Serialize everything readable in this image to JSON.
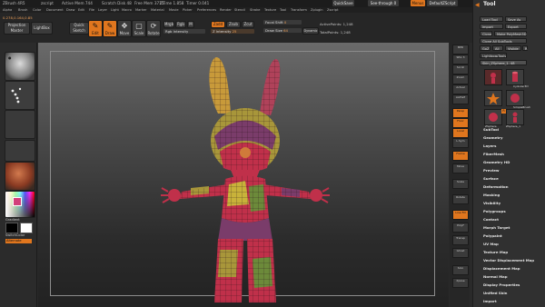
{
  "title_bar": {
    "app": "ZBrush 4R5",
    "items": [
      "zscript",
      "Active Mem 744",
      "Scratch Disk 48",
      "Free Mem 3715",
      "ZTime 1.858",
      "Timer 0.041"
    ],
    "quicksave": "QuickSave",
    "seethrough": "See-through  0",
    "menus": "Menus",
    "default_script": "DefaultZScript"
  },
  "menu_bar": [
    "Alpha",
    "Brush",
    "Color",
    "Document",
    "Draw",
    "Edit",
    "File",
    "Layer",
    "Light",
    "Macro",
    "Marker",
    "Material",
    "Movie",
    "Picker",
    "Preferences",
    "Render",
    "Stencil",
    "Stroke",
    "Texture",
    "Tool",
    "Transform",
    "Zplugin",
    "Zscript"
  ],
  "coords": "0.278,0.164,0.85",
  "shelf": {
    "projection_master": "Projection Master",
    "lightbox": "LightBox",
    "quick_sketch": "Quick Sketch",
    "edit": "Edit",
    "draw": "Draw",
    "move": "Move",
    "scale": "Scale",
    "rotate": "Rotate",
    "mrgb": "Mrgb",
    "rgb": "Rgb",
    "m": "M",
    "zadd": "Zadd",
    "zsub": "Zsub",
    "zcut": "Zcut",
    "rgb_intensity": "Rgb Intensity",
    "z_intensity": "Z Intensity",
    "z_intensity_val": "25",
    "focal_shift": "Focal Shift",
    "focal_shift_val": "0",
    "draw_size": "Draw Size",
    "draw_size_val": "64",
    "dynamic": "Dynamic",
    "active_points": "ActivePoints: 1,248",
    "total_points": "TotalPoints: 1,248"
  },
  "left_shelf": {
    "gradient": "Gradient",
    "switch_color": "SwitchColor",
    "alternate": "Alternate"
  },
  "right_icons": [
    "BPR",
    "SPix 3",
    "Scroll",
    "Zoom",
    "Actual",
    "AAHalf",
    "Persp",
    "Floor",
    "Local",
    "L.Sym",
    "Frame",
    "Move",
    "Scale",
    "Rotate",
    "Line Fill",
    "PolyF",
    "Transp",
    "Ghost",
    "Solo",
    "Xpose"
  ],
  "tool_palette": {
    "title": "Tool",
    "load_tool": "Load Tool",
    "save_as": "Save As",
    "import": "Import",
    "export": "Export",
    "clone": "Clone",
    "make_polymesh": "Make PolyMesh3D",
    "clone_all": "Clone All SubTools",
    "goz": "GoZ",
    "all": "All",
    "visible": "Visible",
    "r": "R",
    "lightbox_tools": "Lightbox▸Tools",
    "current_tool": "Skin_ZSphere_1. 48",
    "thumbnails": [
      "Skin_ZSphere_1",
      "Cylinder3D",
      "PolyMesh3D",
      "SimpleBrush",
      "ZSphere",
      "ZSphere_1"
    ],
    "r_badge": "R"
  },
  "tool_menu": [
    "SubTool",
    "Geometry",
    "Layers",
    "FiberMesh",
    "Geometry HD",
    "Preview",
    "Surface",
    "Deformation",
    "Masking",
    "Visibility",
    "Polygroups",
    "Contact",
    "Morph Target",
    "Polypaint",
    "UV Map",
    "Texture Map",
    "Vector Displacement Map",
    "Displacement Map",
    "Normal Map",
    "Display Properties",
    "Unified Skin",
    "Import"
  ],
  "colors": {
    "accent_orange": "#e0761e",
    "mesh_red": "#c0304a",
    "mesh_yellow": "#c8b23a",
    "mesh_green": "#6c8a3a",
    "mesh_purple": "#7a3c6a"
  }
}
